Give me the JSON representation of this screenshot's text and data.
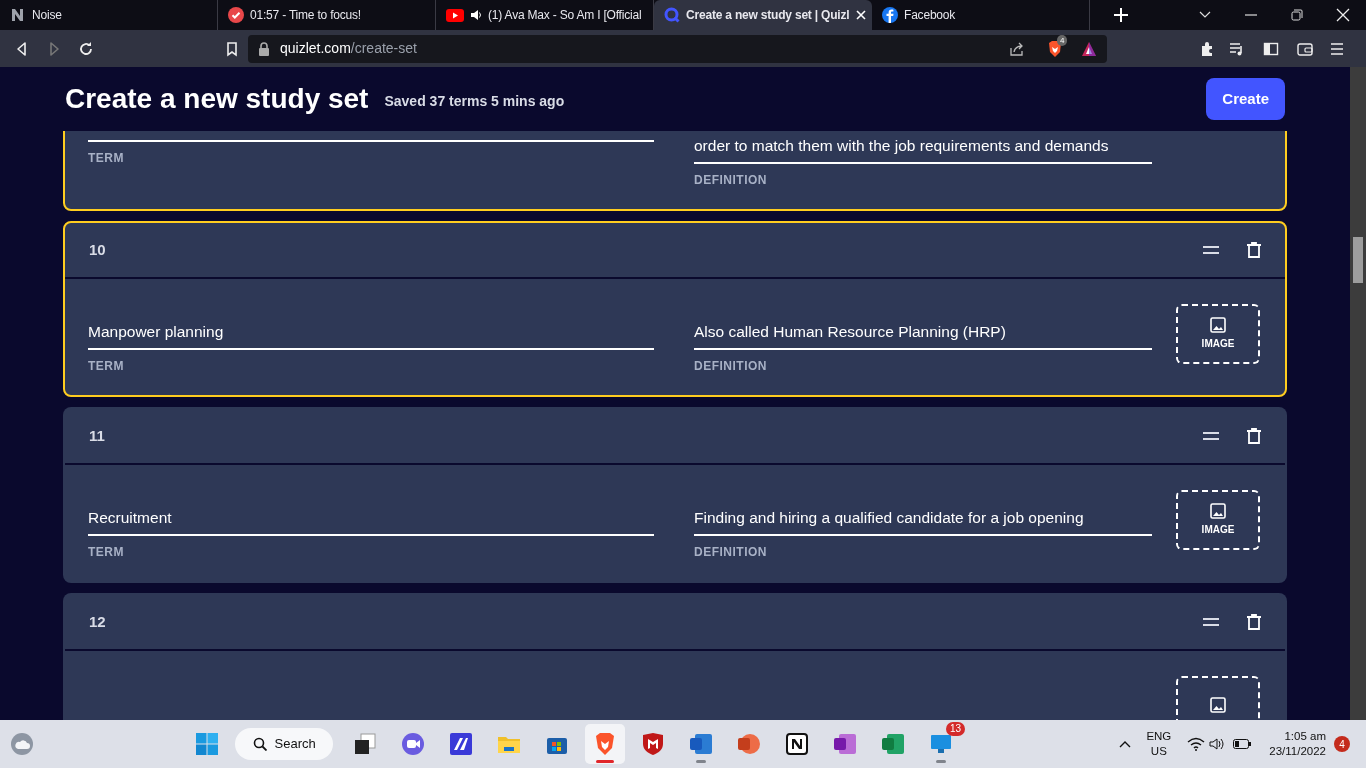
{
  "browser": {
    "tabs": [
      {
        "kind": "noise",
        "title": "Noise",
        "selected": false,
        "audio": false
      },
      {
        "kind": "timer",
        "title": "01:57 - Time to focus!",
        "selected": false,
        "audio": false
      },
      {
        "kind": "video",
        "title": "(1) Ava Max - So Am I [Official",
        "selected": false,
        "audio": true
      },
      {
        "kind": "quizlet",
        "title": "Create a new study set | Quizl",
        "selected": true,
        "audio": false
      },
      {
        "kind": "facebook",
        "title": "Facebook",
        "selected": false,
        "audio": false
      }
    ],
    "address": {
      "host": "quizlet.com",
      "path": "/create-set"
    },
    "shields_count": "4"
  },
  "page": {
    "title": "Create a new study set",
    "status": "Saved 37 terms 5 mins ago",
    "create_button": "Create",
    "cards": [
      {
        "highlighted": true,
        "definition": "order to match them with the job requirements and demands",
        "term_label": "TERM",
        "definition_label": "DEFINITION"
      },
      {
        "number": "10",
        "highlighted": true,
        "term": "Manpower planning",
        "definition": "Also called Human Resource Planning (HRP)",
        "term_label": "TERM",
        "definition_label": "DEFINITION",
        "image_label": "IMAGE"
      },
      {
        "number": "11",
        "highlighted": false,
        "term": "Recruitment",
        "definition": "Finding and hiring a qualified candidate for a job opening",
        "term_label": "TERM",
        "definition_label": "DEFINITION",
        "image_label": "IMAGE"
      },
      {
        "number": "12",
        "highlighted": false
      }
    ]
  },
  "taskbar": {
    "search": "Search",
    "apps": [
      {
        "kind": "taskview",
        "active": false,
        "running": false
      },
      {
        "kind": "chat",
        "active": false,
        "running": false
      },
      {
        "kind": "editor",
        "active": false,
        "running": false
      },
      {
        "kind": "files",
        "active": false,
        "running": false
      },
      {
        "kind": "store",
        "active": false,
        "running": false
      },
      {
        "kind": "brave",
        "active": true,
        "running": true
      },
      {
        "kind": "mcafee",
        "active": false,
        "running": false
      },
      {
        "kind": "word",
        "active": false,
        "running": true
      },
      {
        "kind": "powerpoint",
        "active": false,
        "running": false
      },
      {
        "kind": "notion",
        "active": false,
        "running": false
      },
      {
        "kind": "onenote",
        "active": false,
        "running": false
      },
      {
        "kind": "excel",
        "active": false,
        "running": false
      },
      {
        "kind": "remote",
        "active": false,
        "running": true,
        "badge": "13"
      }
    ],
    "language": "ENG",
    "region": "US",
    "time": "1:05 am",
    "date": "23/11/2022",
    "notifications": "4"
  }
}
